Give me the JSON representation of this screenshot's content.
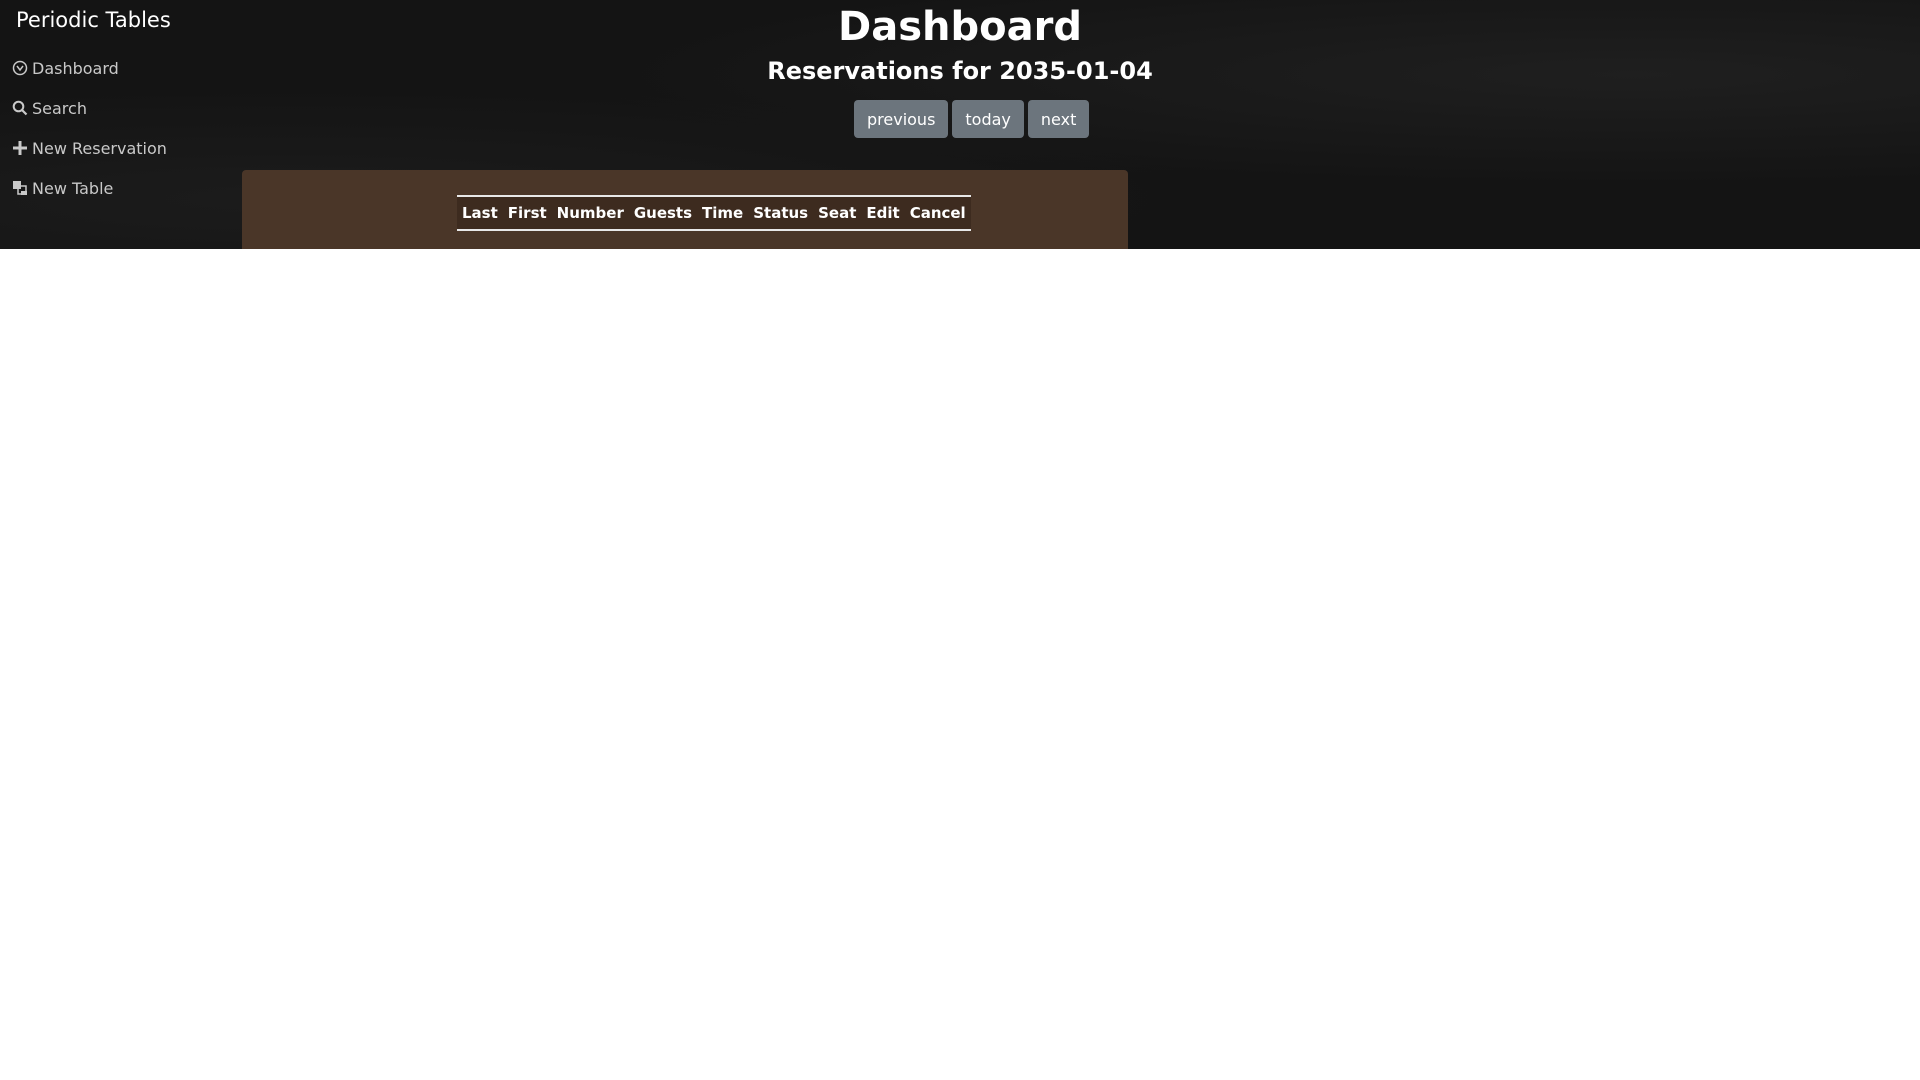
{
  "app": {
    "brand": "Periodic Tables"
  },
  "sidebar": {
    "items": [
      {
        "label": "Dashboard",
        "icon": "dashboard-icon"
      },
      {
        "label": "Search",
        "icon": "search-icon"
      },
      {
        "label": "New Reservation",
        "icon": "plus-icon"
      },
      {
        "label": "New Table",
        "icon": "new-table-icon"
      }
    ]
  },
  "header": {
    "title": "Dashboard",
    "subtitle": "Reservations for 2035-01-04"
  },
  "date_nav": {
    "previous_label": "previous",
    "today_label": "today",
    "next_label": "next"
  },
  "reservations_table": {
    "columns": [
      "Last",
      "First",
      "Number",
      "Guests",
      "Time",
      "Status",
      "Seat",
      "Edit",
      "Cancel"
    ]
  },
  "colors": {
    "header_bg": "#141414",
    "panel_bg": "#4a3628",
    "button_bg": "#6c757d",
    "page_bg": "#ffffff"
  }
}
